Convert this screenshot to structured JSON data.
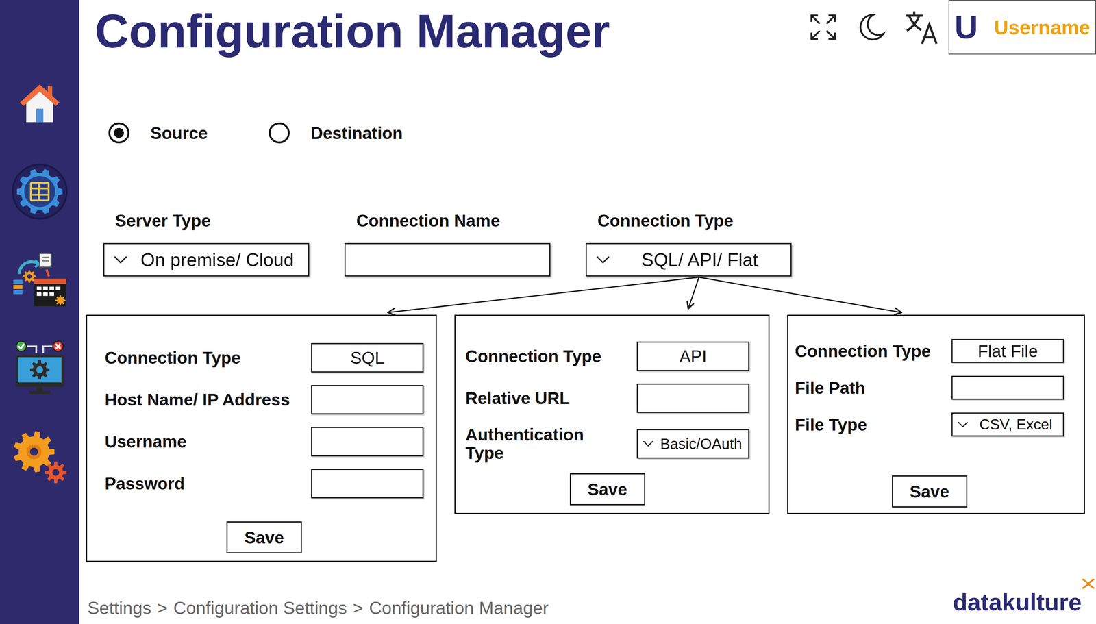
{
  "title": "Configuration Manager",
  "user": {
    "initial": "U",
    "name": "Username"
  },
  "mode": [
    {
      "label": "Source",
      "selected": true
    },
    {
      "label": "Destination",
      "selected": false
    }
  ],
  "fields": [
    {
      "label": "Server Type",
      "kind": "select",
      "value": "On premise/ Cloud"
    },
    {
      "label": "Connection Name",
      "kind": "input",
      "value": ""
    },
    {
      "label": "Connection Type",
      "kind": "select",
      "value": "SQL/ API/ Flat"
    }
  ],
  "panels": [
    {
      "rows": [
        {
          "label": "Connection Type",
          "kind": "value",
          "value": "SQL"
        },
        {
          "label": "Host Name/ IP Address",
          "kind": "input",
          "value": ""
        },
        {
          "label": "Username",
          "kind": "input",
          "value": ""
        },
        {
          "label": "Password",
          "kind": "input",
          "value": ""
        }
      ],
      "button": "Save"
    },
    {
      "rows": [
        {
          "label": "Connection Type",
          "kind": "value",
          "value": "API"
        },
        {
          "label": "Relative URL",
          "kind": "input",
          "value": ""
        },
        {
          "label": "Authentication Type",
          "kind": "select",
          "value": "Basic/OAuth"
        }
      ],
      "button": "Save"
    },
    {
      "rows": [
        {
          "label": "Connection Type",
          "kind": "value",
          "value": "Flat File"
        },
        {
          "label": "File Path",
          "kind": "input",
          "value": ""
        },
        {
          "label": "File Type",
          "kind": "select",
          "value": "CSV, Excel"
        }
      ],
      "button": "Save"
    }
  ],
  "breadcrumb": {
    "items": [
      "Settings",
      "Configuration Settings",
      "Configuration Manager"
    ],
    "separator": ">"
  },
  "logo": {
    "text": "datakulture"
  }
}
